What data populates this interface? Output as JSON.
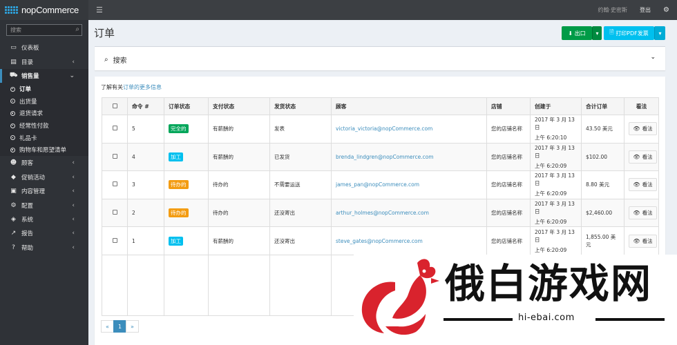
{
  "topbar": {
    "brand": "nopCommerce",
    "user": "约翰·史密斯",
    "logout": "登出"
  },
  "sidebar": {
    "search_placeholder": "搜索",
    "items_top": [
      {
        "label": "仪表板",
        "icon": "desktop-icon",
        "glyph": "🖥",
        "chevron": false
      }
    ],
    "catalog": {
      "label": "目录",
      "icon": "book-icon",
      "glyph": "▤",
      "chevron": true
    },
    "sales": {
      "label": "销售量",
      "icon": "shopping-cart-icon",
      "glyph": "🛒",
      "chevron": true
    },
    "sales_children": [
      {
        "label": "订单",
        "active": true
      },
      {
        "label": "出货量",
        "active": false
      },
      {
        "label": "退货请求",
        "active": false
      },
      {
        "label": "经常性付款",
        "active": false
      },
      {
        "label": "礼品卡",
        "active": false
      },
      {
        "label": "购物车和愿望清单",
        "active": false
      }
    ],
    "items_bottom": [
      {
        "label": "顾客",
        "icon": "user-icon",
        "glyph": "👤",
        "chevron": true
      },
      {
        "label": "促销活动",
        "icon": "tag-icon",
        "glyph": "🏷",
        "chevron": true
      },
      {
        "label": "内容管理",
        "icon": "cubes-icon",
        "glyph": "▣",
        "chevron": true
      },
      {
        "label": "配置",
        "icon": "cogs-icon",
        "glyph": "⚙",
        "chevron": true
      },
      {
        "label": "系统",
        "icon": "cube-icon",
        "glyph": "◈",
        "chevron": true
      },
      {
        "label": "报告",
        "icon": "line-chart-icon",
        "glyph": "📈",
        "chevron": true
      },
      {
        "label": "帮助",
        "icon": "question-circle-icon",
        "glyph": "?",
        "chevron": true
      }
    ]
  },
  "page": {
    "title": "订单",
    "export_label": "出口",
    "print_pdf_label": "打印PDF发票",
    "search_label": "搜索",
    "info_prefix": "了解有关",
    "info_link": "订单的更多信息"
  },
  "grid": {
    "headers": [
      "命令 #",
      "订单状态",
      "支付状态",
      "发货状态",
      "顾客",
      "店铺",
      "创建于",
      "合计订单",
      "看法"
    ],
    "rows": [
      {
        "id": "5",
        "order_status": "完全的",
        "order_status_kind": "complete",
        "payment": "有薪酬的",
        "shipping": "发表",
        "customer": "victoria_victoria@nopCommerce.com",
        "store": "您的店铺名称",
        "created_1": "2017 年 3 月 13 日",
        "created_2": "上午 6:20:10",
        "total": "43.50 美元",
        "view": "看法"
      },
      {
        "id": "4",
        "order_status": "加工",
        "order_status_kind": "processing",
        "payment": "有薪酬的",
        "shipping": "已发货",
        "customer": "brenda_lindgren@nopCommerce.com",
        "store": "您的店铺名称",
        "created_1": "2017 年 3 月 13 日",
        "created_2": "上午 6:20:09",
        "total": "$102.00",
        "view": "看法"
      },
      {
        "id": "3",
        "order_status": "待办的",
        "order_status_kind": "pending",
        "payment": "待办的",
        "shipping": "不需要运送",
        "customer": "james_pan@nopCommerce.com",
        "store": "您的店铺名称",
        "created_1": "2017 年 3 月 13 日",
        "created_2": "上午 6:20:09",
        "total": "8.80 美元",
        "view": "看法"
      },
      {
        "id": "2",
        "order_status": "待办的",
        "order_status_kind": "pending",
        "payment": "待办的",
        "shipping": "还没寄出",
        "customer": "arthur_holmes@nopCommerce.com",
        "store": "您的店铺名称",
        "created_1": "2017 年 3 月 13 日",
        "created_2": "上午 6:20:09",
        "total": "$2,460.00",
        "view": "看法"
      },
      {
        "id": "1",
        "order_status": "加工",
        "order_status_kind": "processing",
        "payment": "有薪酬的",
        "shipping": "还没寄出",
        "customer": "steve_gates@nopCommerce.com",
        "store": "您的店铺名称",
        "created_1": "2017 年 3 月 13 日",
        "created_2": "上午 6:20:09",
        "total": "1,855.00 美元",
        "view": "看法"
      }
    ]
  },
  "pager": {
    "prev": "«",
    "current": "1",
    "next": "»"
  },
  "watermark": {
    "text": "俄白游戏网",
    "url": "hi-ebai.com",
    "color": "#d9232d"
  },
  "colors": {
    "accent": "#3c8dbc",
    "export_green": "#009b47",
    "pdf_cyan": "#00c0ef",
    "badge_complete": "#00a65a",
    "badge_processing": "#00c0ef",
    "badge_pending": "#f39c12"
  }
}
